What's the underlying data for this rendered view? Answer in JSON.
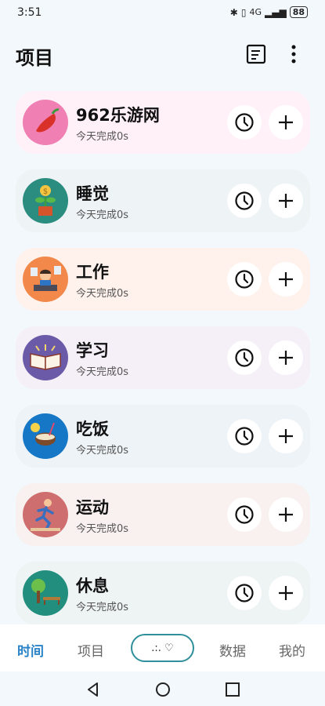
{
  "status_bar": {
    "time": "3:51",
    "network": "4G",
    "battery": "88"
  },
  "header": {
    "title": "项目"
  },
  "items": [
    {
      "name": "962乐游网",
      "sub": "今天完成0s",
      "bg": "#fff1f7",
      "avatar_bg": "#f07fb4",
      "icon": "chili-icon"
    },
    {
      "name": "睡觉",
      "sub": "今天完成0s",
      "bg": "#eef3f6",
      "avatar_bg": "#2b8c80",
      "icon": "money-plant-icon"
    },
    {
      "name": "工作",
      "sub": "今天完成0s",
      "bg": "#fff2ec",
      "avatar_bg": "#f2894a",
      "icon": "office-worker-icon"
    },
    {
      "name": "学习",
      "sub": "今天完成0s",
      "bg": "#f5f0f7",
      "avatar_bg": "#6b5aa8",
      "icon": "book-icon"
    },
    {
      "name": "吃饭",
      "sub": "今天完成0s",
      "bg": "#eef3f7",
      "avatar_bg": "#1577c6",
      "icon": "coconut-drink-icon"
    },
    {
      "name": "运动",
      "sub": "今天完成0s",
      "bg": "#f8f1ef",
      "avatar_bg": "#cf6e6e",
      "icon": "runner-icon"
    },
    {
      "name": "休息",
      "sub": "今天完成0s",
      "bg": "#eef3f4",
      "avatar_bg": "#228f7e",
      "icon": "park-bench-icon"
    }
  ],
  "bottom_nav": {
    "tabs": [
      "时间",
      "项目",
      "数据",
      "我的"
    ],
    "center": ".:. ♡",
    "active": "时间",
    "active_color": "#2a83c7"
  }
}
